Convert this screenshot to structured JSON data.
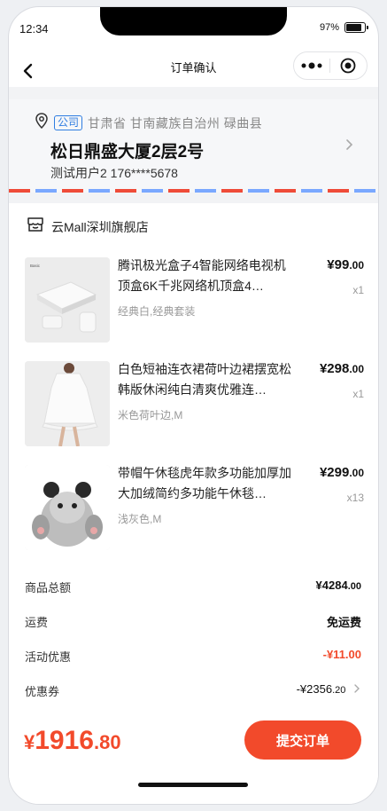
{
  "status": {
    "time": "12:34",
    "battery": "97%"
  },
  "nav": {
    "title": "订单确认"
  },
  "address": {
    "tag": "公司",
    "region": "甘肃省 甘南藏族自治州 碌曲县",
    "detail": "松日鼎盛大厦2层2号",
    "contact": "测试用户2 176****5678"
  },
  "shop": {
    "name": "云Mall深圳旗舰店"
  },
  "goods": [
    {
      "title": "腾讯极光盒子4智能网络电视机顶盒6K千兆网络机顶盒4…",
      "spec": "经典白,经典套装",
      "price_int": "¥99",
      "price_dec": ".00",
      "qty": "x1",
      "thumb_text": "Basic"
    },
    {
      "title": "白色短袖连衣裙荷叶边裙摆宽松韩版休闲纯白清爽优雅连…",
      "spec": "米色荷叶边,M",
      "price_int": "¥298",
      "price_dec": ".00",
      "qty": "x1"
    },
    {
      "title": "带帽午休毯虎年款多功能加厚加大加绒简约多功能午休毯…",
      "spec": "浅灰色,M",
      "price_int": "¥299",
      "price_dec": ".00",
      "qty": "x13"
    }
  ],
  "summary": {
    "goods_total_label": "商品总额",
    "goods_total_int": "¥4284",
    "goods_total_dec": ".00",
    "shipping_label": "运费",
    "shipping_value": "免运费",
    "promo_label": "活动优惠",
    "promo_value": "-¥11.00",
    "coupon_label": "优惠券",
    "coupon_int": "-¥2356",
    "coupon_dec": ".20"
  },
  "footer": {
    "sym": "¥",
    "total_int": "1916",
    "total_dec": ".80",
    "submit_label": "提交订单"
  },
  "colors": {
    "accent": "#f24a2b",
    "tag_blue": "#2f7de1"
  }
}
